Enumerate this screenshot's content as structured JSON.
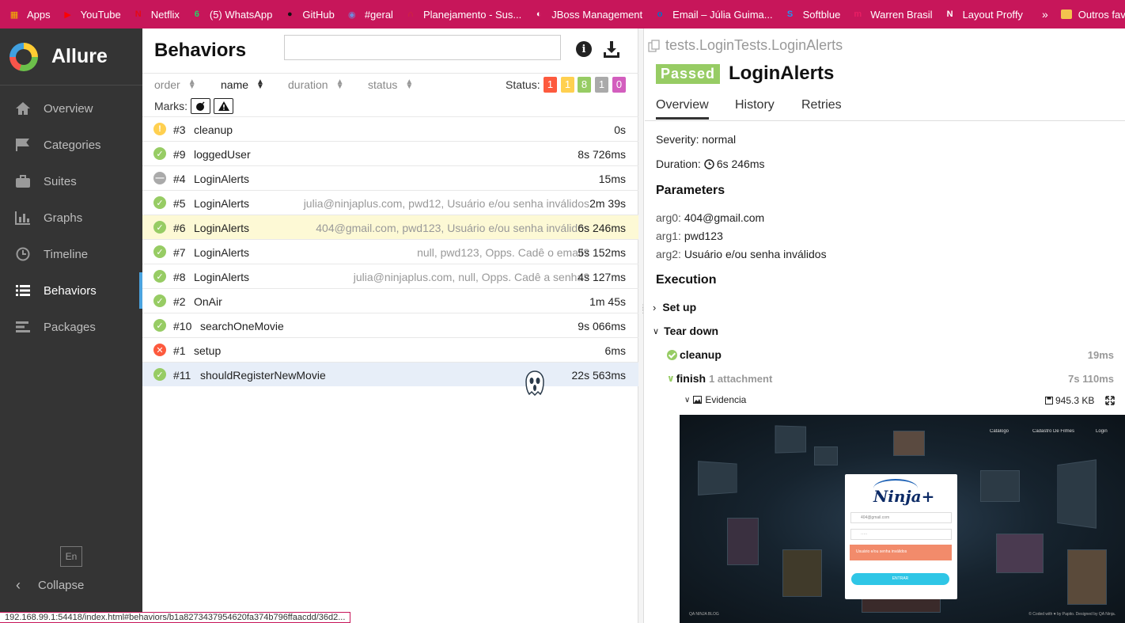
{
  "bookmarks": {
    "items": [
      {
        "label": "Apps",
        "icon": "apps-grid-icon",
        "color": "#f4b400"
      },
      {
        "label": "YouTube",
        "icon": "youtube-icon",
        "color": "#ff0000"
      },
      {
        "label": "Netflix",
        "icon": "netflix-icon",
        "color": "#e50914"
      },
      {
        "label": "(5) WhatsApp",
        "icon": "whatsapp-icon",
        "color": "#25d366"
      },
      {
        "label": "GitHub",
        "icon": "github-icon",
        "color": "#111111"
      },
      {
        "label": "#geral",
        "icon": "discord-icon",
        "color": "#7289da"
      },
      {
        "label": "Planejamento - Sus...",
        "icon": "headset-icon",
        "color": "#d32f2f"
      },
      {
        "label": "JBoss Management",
        "icon": "globe-icon",
        "color": "#ffffff"
      },
      {
        "label": "Email – Júlia Guima...",
        "icon": "outlook-icon",
        "color": "#0072c6"
      },
      {
        "label": "Softblue",
        "icon": "softblue-icon",
        "color": "#2196f3"
      },
      {
        "label": "Warren Brasil",
        "icon": "warren-icon",
        "color": "#e91e63"
      },
      {
        "label": "Layout Proffy",
        "icon": "notion-icon",
        "color": "#ffffff"
      }
    ],
    "more": "»",
    "other_folder": "Outros favoritos"
  },
  "sidebar": {
    "brand": "Allure",
    "items": [
      {
        "label": "Overview",
        "icon": "home-icon"
      },
      {
        "label": "Categories",
        "icon": "flag-icon"
      },
      {
        "label": "Suites",
        "icon": "briefcase-icon"
      },
      {
        "label": "Graphs",
        "icon": "bar-chart-icon"
      },
      {
        "label": "Timeline",
        "icon": "clock-icon"
      },
      {
        "label": "Behaviors",
        "icon": "list-icon",
        "active": true
      },
      {
        "label": "Packages",
        "icon": "align-left-icon"
      }
    ],
    "lang": "En",
    "collapse": "Collapse"
  },
  "behaviors": {
    "title": "Behaviors",
    "search_placeholder": "",
    "sort": {
      "order": "order",
      "name": "name",
      "duration": "duration",
      "status": "status"
    },
    "status_label": "Status:",
    "status_counts": [
      {
        "value": "1",
        "color": "#fd5a3e"
      },
      {
        "value": "1",
        "color": "#ffd050"
      },
      {
        "value": "8",
        "color": "#97cc64"
      },
      {
        "value": "1",
        "color": "#aaaaaa"
      },
      {
        "value": "0",
        "color": "#d35ebe"
      }
    ],
    "marks_label": "Marks:",
    "rows": [
      {
        "status": "broken",
        "num": "#3",
        "name": "cleanup",
        "params": "",
        "duration": "0s"
      },
      {
        "status": "passed",
        "num": "#9",
        "name": "loggedUser",
        "params": "",
        "duration": "8s 726ms"
      },
      {
        "status": "skipped",
        "num": "#4",
        "name": "LoginAlerts",
        "params": "",
        "duration": "15ms"
      },
      {
        "status": "passed",
        "num": "#5",
        "name": "LoginAlerts",
        "params": "julia@ninjaplus.com, pwd12, Usuário e/ou senha inválidos",
        "duration": "2m 39s"
      },
      {
        "status": "passed",
        "num": "#6",
        "name": "LoginAlerts",
        "params": "404@gmail.com, pwd123, Usuário e/ou senha inválidos",
        "duration": "6s 246ms",
        "selected": true
      },
      {
        "status": "passed",
        "num": "#7",
        "name": "LoginAlerts",
        "params": "null, pwd123, Opps. Cadê o email?",
        "duration": "5s 152ms"
      },
      {
        "status": "passed",
        "num": "#8",
        "name": "LoginAlerts",
        "params": "julia@ninjaplus.com, null, Opps. Cadê a senha?",
        "duration": "4s 127ms"
      },
      {
        "status": "passed",
        "num": "#2",
        "name": "OnAir",
        "params": "",
        "duration": "1m 45s"
      },
      {
        "status": "passed",
        "num": "#10",
        "name": "searchOneMovie",
        "params": "",
        "duration": "9s 066ms"
      },
      {
        "status": "failed",
        "num": "#1",
        "name": "setup",
        "params": "",
        "duration": "6ms"
      },
      {
        "status": "passed",
        "num": "#11",
        "name": "shouldRegisterNewMovie",
        "params": "",
        "duration": "22s 563ms",
        "hover": true
      }
    ]
  },
  "detail": {
    "path": "tests.LoginTests.LoginAlerts",
    "status": "Passed",
    "title": "LoginAlerts",
    "tabs": [
      "Overview",
      "History",
      "Retries"
    ],
    "severity_label": "Severity:",
    "severity": "normal",
    "duration_label": "Duration:",
    "duration": "6s 246ms",
    "parameters_title": "Parameters",
    "params": [
      {
        "k": "arg0:",
        "v": "404@gmail.com"
      },
      {
        "k": "arg1:",
        "v": "pwd123"
      },
      {
        "k": "arg2:",
        "v": "Usuário e/ou senha inválidos"
      }
    ],
    "execution_title": "Execution",
    "setup": "Set up",
    "teardown": "Tear down",
    "cleanup": "cleanup",
    "cleanup_time": "19ms",
    "finish": "finish",
    "finish_attach": "1 attachment",
    "finish_time": "7s 110ms",
    "evidence": "Evidencia",
    "evidence_size": "945.3 KB",
    "preview": {
      "nav": [
        "Catálogo",
        "Cadastro De Filmes",
        "Login"
      ],
      "logo": "Ninja+",
      "email": "404@gmail.com",
      "password": "·····",
      "error": "Usuário e/ou senha inválidos",
      "button": "ENTRAR",
      "footer_left": "QA NINJA     BLOG",
      "footer_right": "© Coded with ♥ by Papito. Designed by QA Ninja."
    }
  },
  "status_url": "192.168.99.1:54418/index.html#behaviors/b1a8273437954620fa374b796ffaacdd/36d2..."
}
